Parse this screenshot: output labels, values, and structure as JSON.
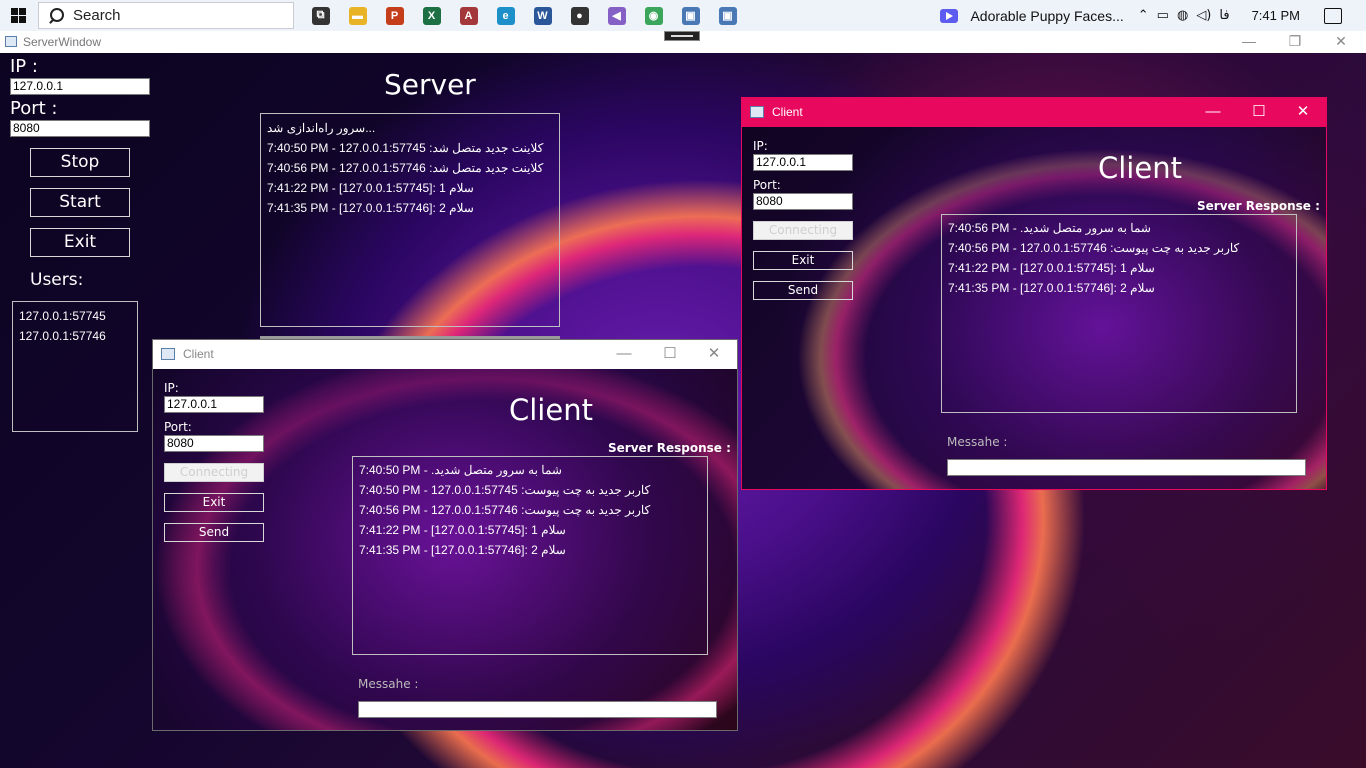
{
  "taskbar": {
    "search_placeholder": "Search",
    "apps": [
      {
        "name": "task-view-icon",
        "glyph": "⧉",
        "color": "#333333"
      },
      {
        "name": "file-explorer-icon",
        "glyph": "▬",
        "color": "#e8b325"
      },
      {
        "name": "powerpoint-icon",
        "glyph": "P",
        "color": "#c43e1c"
      },
      {
        "name": "excel-icon",
        "glyph": "X",
        "color": "#1d7044"
      },
      {
        "name": "access-icon",
        "glyph": "A",
        "color": "#a4373a"
      },
      {
        "name": "edge-icon",
        "glyph": "e",
        "color": "#1e90c9"
      },
      {
        "name": "word-icon",
        "glyph": "W",
        "color": "#2b579a"
      },
      {
        "name": "github-icon",
        "glyph": "●",
        "color": "#333333"
      },
      {
        "name": "visual-studio-icon",
        "glyph": "◀",
        "color": "#8661c5"
      },
      {
        "name": "chrome-icon",
        "glyph": "◉",
        "color": "#3ba55c"
      },
      {
        "name": "app-window-icon-1",
        "glyph": "▣",
        "color": "#4a78b5"
      },
      {
        "name": "app-window-icon-2",
        "glyph": "▣",
        "color": "#4a78b5"
      }
    ],
    "media_title": "Adorable Puppy Faces...",
    "language": "فا",
    "clock": "7:41 PM"
  },
  "server": {
    "window_title": "ServerWindow",
    "ip_label": "IP :",
    "ip_value": "127.0.0.1",
    "port_label": "Port :",
    "port_value": "8080",
    "stop_label": "Stop",
    "start_label": "Start",
    "exit_label": "Exit",
    "users_label": "Users:",
    "users": [
      "127.0.0.1:57745",
      "127.0.0.1:57746"
    ],
    "heading": "Server",
    "log": [
      "سرور راه‌اندازی شد...",
      "",
      "7:40:50 PM - 127.0.0.1:57745 :کلاینت جدید متصل شد",
      "7:40:56 PM - 127.0.0.1:57746 :کلاینت جدید متصل شد",
      "7:41:22 PM - [127.0.0.1:57745]: سلام 1",
      "7:41:35 PM - [127.0.0.1:57746]: سلام 2"
    ]
  },
  "client1": {
    "window_title": "Client",
    "ip_label": "IP:",
    "ip_value": "127.0.0.1",
    "port_label": "Port:",
    "port_value": "8080",
    "connect_label": "Connecting",
    "exit_label": "Exit",
    "send_label": "Send",
    "heading": "Client",
    "response_label": "Server Response :",
    "responses": [
      "7:40:50 PM - .شما به سرور متصل شدید",
      "7:40:50 PM - 127.0.0.1:57745 :کاربر جدید به چت پیوست",
      "7:40:56 PM - 127.0.0.1:57746 :کاربر جدید به چت پیوست",
      "7:41:22 PM - [127.0.0.1:57745]: سلام 1",
      "7:41:35 PM - [127.0.0.1:57746]: سلام 2"
    ],
    "message_label": "Messahe :",
    "message_value": ""
  },
  "client2": {
    "window_title": "Client",
    "ip_label": "IP:",
    "ip_value": "127.0.0.1",
    "port_label": "Port:",
    "port_value": "8080",
    "connect_label": "Connecting",
    "exit_label": "Exit",
    "send_label": "Send",
    "heading": "Client",
    "response_label": "Server Response :",
    "responses": [
      "7:40:56 PM - .شما به سرور متصل شدید",
      "7:40:56 PM - 127.0.0.1:57746 :کاربر جدید به چت پیوست",
      "7:41:22 PM - [127.0.0.1:57745]: سلام 1",
      "7:41:35 PM - [127.0.0.1:57746]: سلام 2"
    ],
    "message_label": "Messahe :",
    "message_value": ""
  },
  "colors": {
    "active_titlebar": "#e8095f",
    "inactive_titlebar": "#ffffff"
  }
}
